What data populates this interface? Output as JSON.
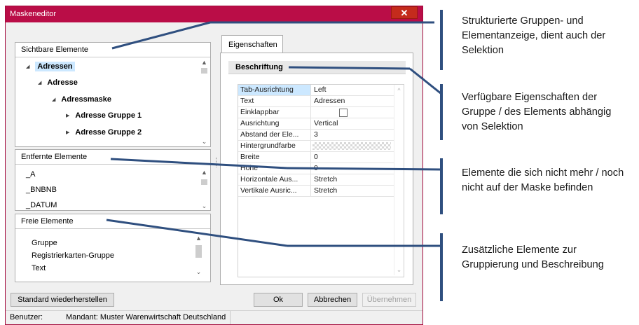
{
  "window": {
    "title": "Maskeneditor",
    "close_glyph": "✕"
  },
  "visible_group": {
    "label": "Sichtbare Elemente",
    "items": [
      {
        "label": "Adressen",
        "level": 0,
        "expanded": true,
        "selected": true
      },
      {
        "label": "Adresse",
        "level": 1,
        "expanded": true
      },
      {
        "label": "Adressmaske",
        "level": 2,
        "expanded": true
      },
      {
        "label": "Adresse Gruppe 1",
        "level": 3,
        "expanded": false
      },
      {
        "label": "Adresse Gruppe 2",
        "level": 3,
        "expanded": false
      }
    ]
  },
  "removed_group": {
    "label": "Entfernte Elemente",
    "items": [
      "_A",
      "_BNBNB",
      "_DATUM"
    ]
  },
  "free_group": {
    "label": "Freie Elemente",
    "items": [
      "Gruppe",
      "Registrierkarten-Gruppe",
      "Text"
    ]
  },
  "properties": {
    "tab_label": "Eigenschaften",
    "section_label": "Beschriftung",
    "rows": [
      {
        "key": "Tab-Ausrichtung",
        "value": "Left"
      },
      {
        "key": "Text",
        "value": "Adressen"
      },
      {
        "key": "Einklappbar",
        "value": "",
        "checkbox": true
      },
      {
        "key": "Ausrichtung",
        "value": "Vertical"
      },
      {
        "key": "Abstand der Ele...",
        "value": "3"
      },
      {
        "key": "Hintergrundfarbe",
        "value": "",
        "pattern": true
      },
      {
        "key": "Breite",
        "value": "0"
      },
      {
        "key": "Höhe",
        "value": "0"
      },
      {
        "key": "Horizontale Aus...",
        "value": "Stretch"
      },
      {
        "key": "Vertikale Ausric...",
        "value": "Stretch"
      }
    ]
  },
  "buttons": {
    "reset": "Standard wiederherstellen",
    "ok": "Ok",
    "cancel": "Abbrechen",
    "apply": "Übernehmen"
  },
  "status": {
    "user_label": "Benutzer:",
    "client": "Mandant: Muster Warenwirtschaft Deutschland"
  },
  "annotations": [
    {
      "text": "Strukturierte Gruppen- und Elementanzeige, dient auch der Selektion"
    },
    {
      "text": "Verfügbare Eigenschaften der Gruppe / des Elements abhängig von Selektion"
    },
    {
      "text": "Elemente die sich nicht mehr / noch nicht auf der Maske befinden"
    },
    {
      "text": "Zusätzliche Elemente zur Gruppierung und Beschreibung"
    }
  ],
  "colors": {
    "titlebar": "#ba0d47",
    "close": "#c42b1c",
    "line": "#2f4f7f",
    "selection": "#cce8ff"
  }
}
